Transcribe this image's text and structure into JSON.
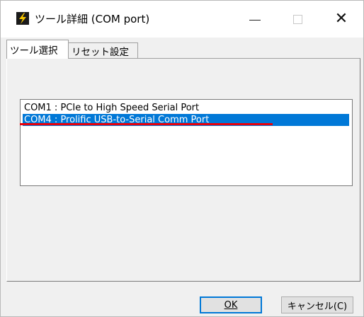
{
  "window": {
    "title": "ツール詳細 (COM port)",
    "icon": "lightning-icon"
  },
  "titlebar": {
    "minimize_icon": "minimize-icon",
    "maximize_icon": "maximize-icon",
    "close_icon": "close-icon"
  },
  "tabs": [
    {
      "label": "ツール選択",
      "active": true
    },
    {
      "label": "リセット設定",
      "active": false
    }
  ],
  "port_list": {
    "items": [
      "COM1 : PCIe to High Speed Serial Port",
      "COM4 : Prolific USB-to-Serial Comm Port"
    ],
    "selected_index": 1,
    "selection_color": "#0078d7",
    "highlight_mark_color": "#e8000b"
  },
  "buttons": {
    "ok": "OK",
    "cancel": "キャンセル(C)"
  }
}
